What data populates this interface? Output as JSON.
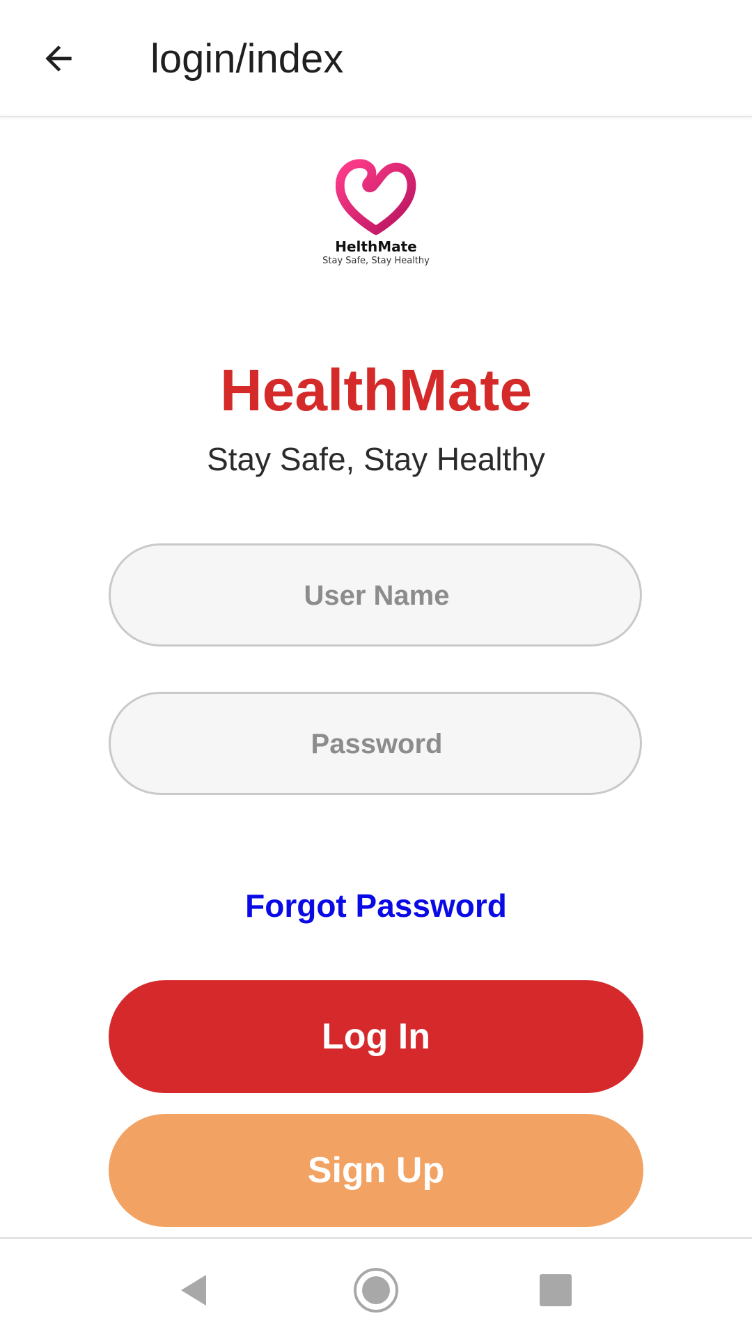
{
  "app_bar": {
    "title": "login/index",
    "back_icon": "arrow-left-icon"
  },
  "logo": {
    "name": "HelthMate",
    "tagline": "Stay Safe, Stay Healthy",
    "icon": "heart-logo-icon"
  },
  "brand": {
    "title": "HealthMate",
    "tagline": "Stay Safe, Stay Healthy"
  },
  "form": {
    "username": {
      "value": "",
      "placeholder": "User Name"
    },
    "password": {
      "value": "",
      "placeholder": "Password"
    },
    "forgot_label": "Forgot Password",
    "login_label": "Log In",
    "signup_label": "Sign Up"
  },
  "nav_bar": {
    "back_icon": "triangle-back-icon",
    "home_icon": "circle-home-icon",
    "recents_icon": "square-recents-icon"
  },
  "colors": {
    "brand_red": "#d52a2a",
    "login_button": "#d5292b",
    "signup_button": "#f2a262",
    "link_blue": "#0a0ae6",
    "field_background": "#f6f6f6",
    "field_border": "#c9c9c9"
  }
}
